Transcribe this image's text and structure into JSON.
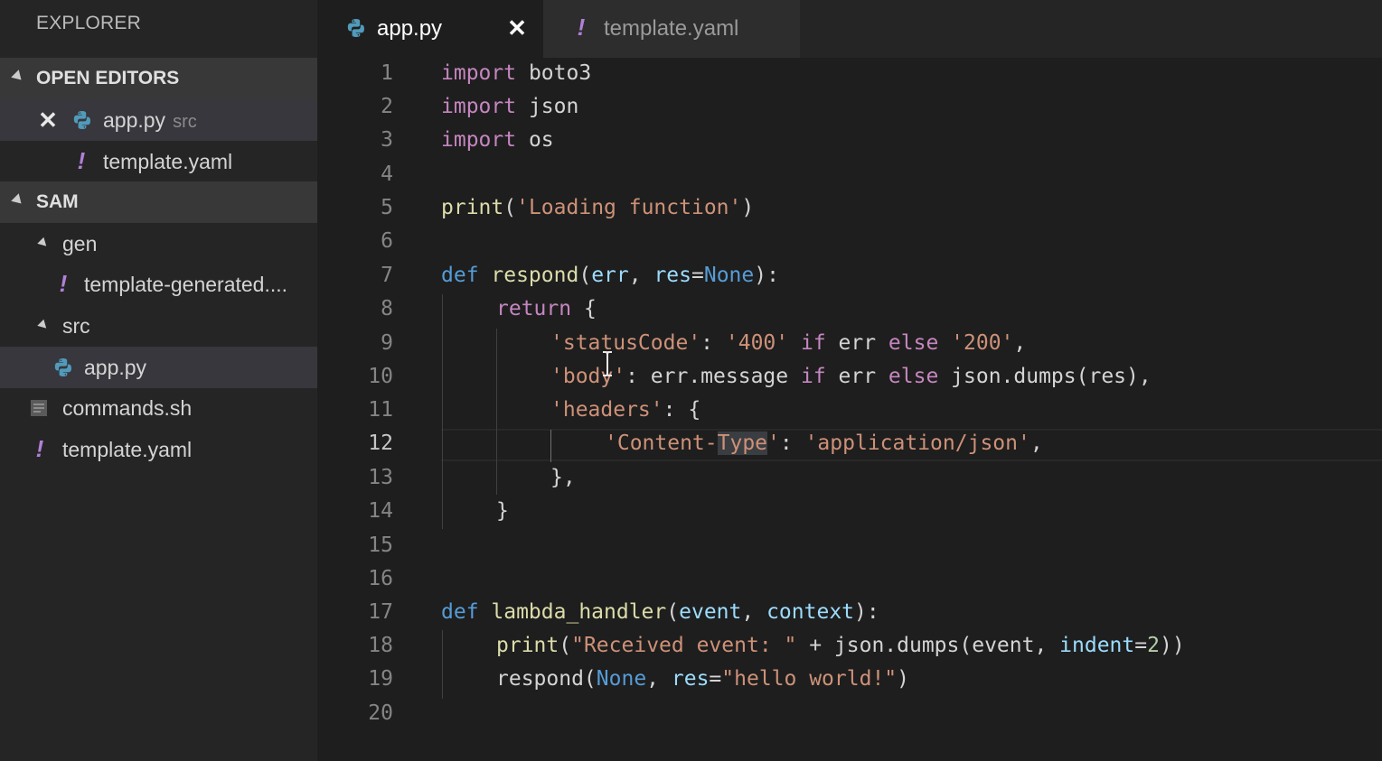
{
  "sidebar": {
    "title": "EXPLORER",
    "open_editors": {
      "label": "OPEN EDITORS",
      "items": [
        {
          "name": "app.py",
          "detail": "src"
        },
        {
          "name": "template.yaml"
        }
      ]
    },
    "project": {
      "label": "SAM",
      "folders": [
        {
          "name": "gen",
          "files": [
            "template-generated...."
          ]
        },
        {
          "name": "src",
          "files": [
            "app.py"
          ]
        }
      ],
      "files": [
        "commands.sh",
        "template.yaml"
      ]
    }
  },
  "tabs": [
    {
      "label": "app.py",
      "close": "✕"
    },
    {
      "label": "template.yaml"
    }
  ],
  "editor": {
    "line_numbers": [
      "1",
      "2",
      "3",
      "4",
      "5",
      "6",
      "7",
      "8",
      "9",
      "10",
      "11",
      "12",
      "13",
      "14",
      "15",
      "16",
      "17",
      "18",
      "19",
      "20"
    ],
    "current_line": 12,
    "code": {
      "l1_kw": "import",
      "l1_mod": " boto3",
      "l2_kw": "import",
      "l2_mod": " json",
      "l3_kw": "import",
      "l3_mod": " os",
      "l5_fn": "print",
      "l5_open": "(",
      "l5_str": "'Loading function'",
      "l5_close": ")",
      "l7_def": "def",
      "l7_fn": " respond",
      "l7_open": "(",
      "l7_p1": "err",
      "l7_comma": ", ",
      "l7_p2": "res",
      "l7_eq": "=",
      "l7_none": "None",
      "l7_close": "):",
      "l8_ret": "return",
      "l8_rest": " {",
      "l9_k": "'statusCode'",
      "l9_c": ": ",
      "l9_v1": "'400'",
      "l9_if": " if",
      "l9_err": " err",
      "l9_else": " else",
      "l9_sp": " ",
      "l9_v2": "'200'",
      "l9_end": ",",
      "l10_k": "'body'",
      "l10_c": ": err.message ",
      "l10_if": "if",
      "l10_err": " err ",
      "l10_else": "else",
      "l10_rest": " json.dumps(res),",
      "l11_k": "'headers'",
      "l11_c": ": {",
      "l12_k1": "'Content-",
      "l12_k2": "Type",
      "l12_k3": "'",
      "l12_c": ": ",
      "l12_v": "'application/json'",
      "l12_end": ",",
      "l13": "},",
      "l14": "}",
      "l17_def": "def",
      "l17_fn": " lambda_handler",
      "l17_open": "(",
      "l17_p1": "event",
      "l17_comma": ", ",
      "l17_p2": "context",
      "l17_close": "):",
      "l18_fn": "print",
      "l18_open": "(",
      "l18_str": "\"Received event: \"",
      "l18_mid": " + json.dumps(event, ",
      "l18_p": "indent",
      "l18_eq": "=",
      "l18_num": "2",
      "l18_close": "))",
      "l19_fn": "respond(",
      "l19_none": "None",
      "l19_comma": ", ",
      "l19_p": "res",
      "l19_eq": "=",
      "l19_str": "\"hello world!\"",
      "l19_close": ")"
    }
  },
  "colors": {
    "keyword": "#c586c0",
    "def": "#569cd6",
    "function": "#dcdcaa",
    "string": "#ce9178",
    "param": "#9cdcfe",
    "number": "#b5cea8",
    "python_icon": "#519aba",
    "yaml_icon": "#b180d7"
  },
  "icons": {
    "python": "python-icon",
    "yaml": "yaml-exclamation-icon",
    "shell": "file-lines-icon",
    "close": "close-icon"
  }
}
